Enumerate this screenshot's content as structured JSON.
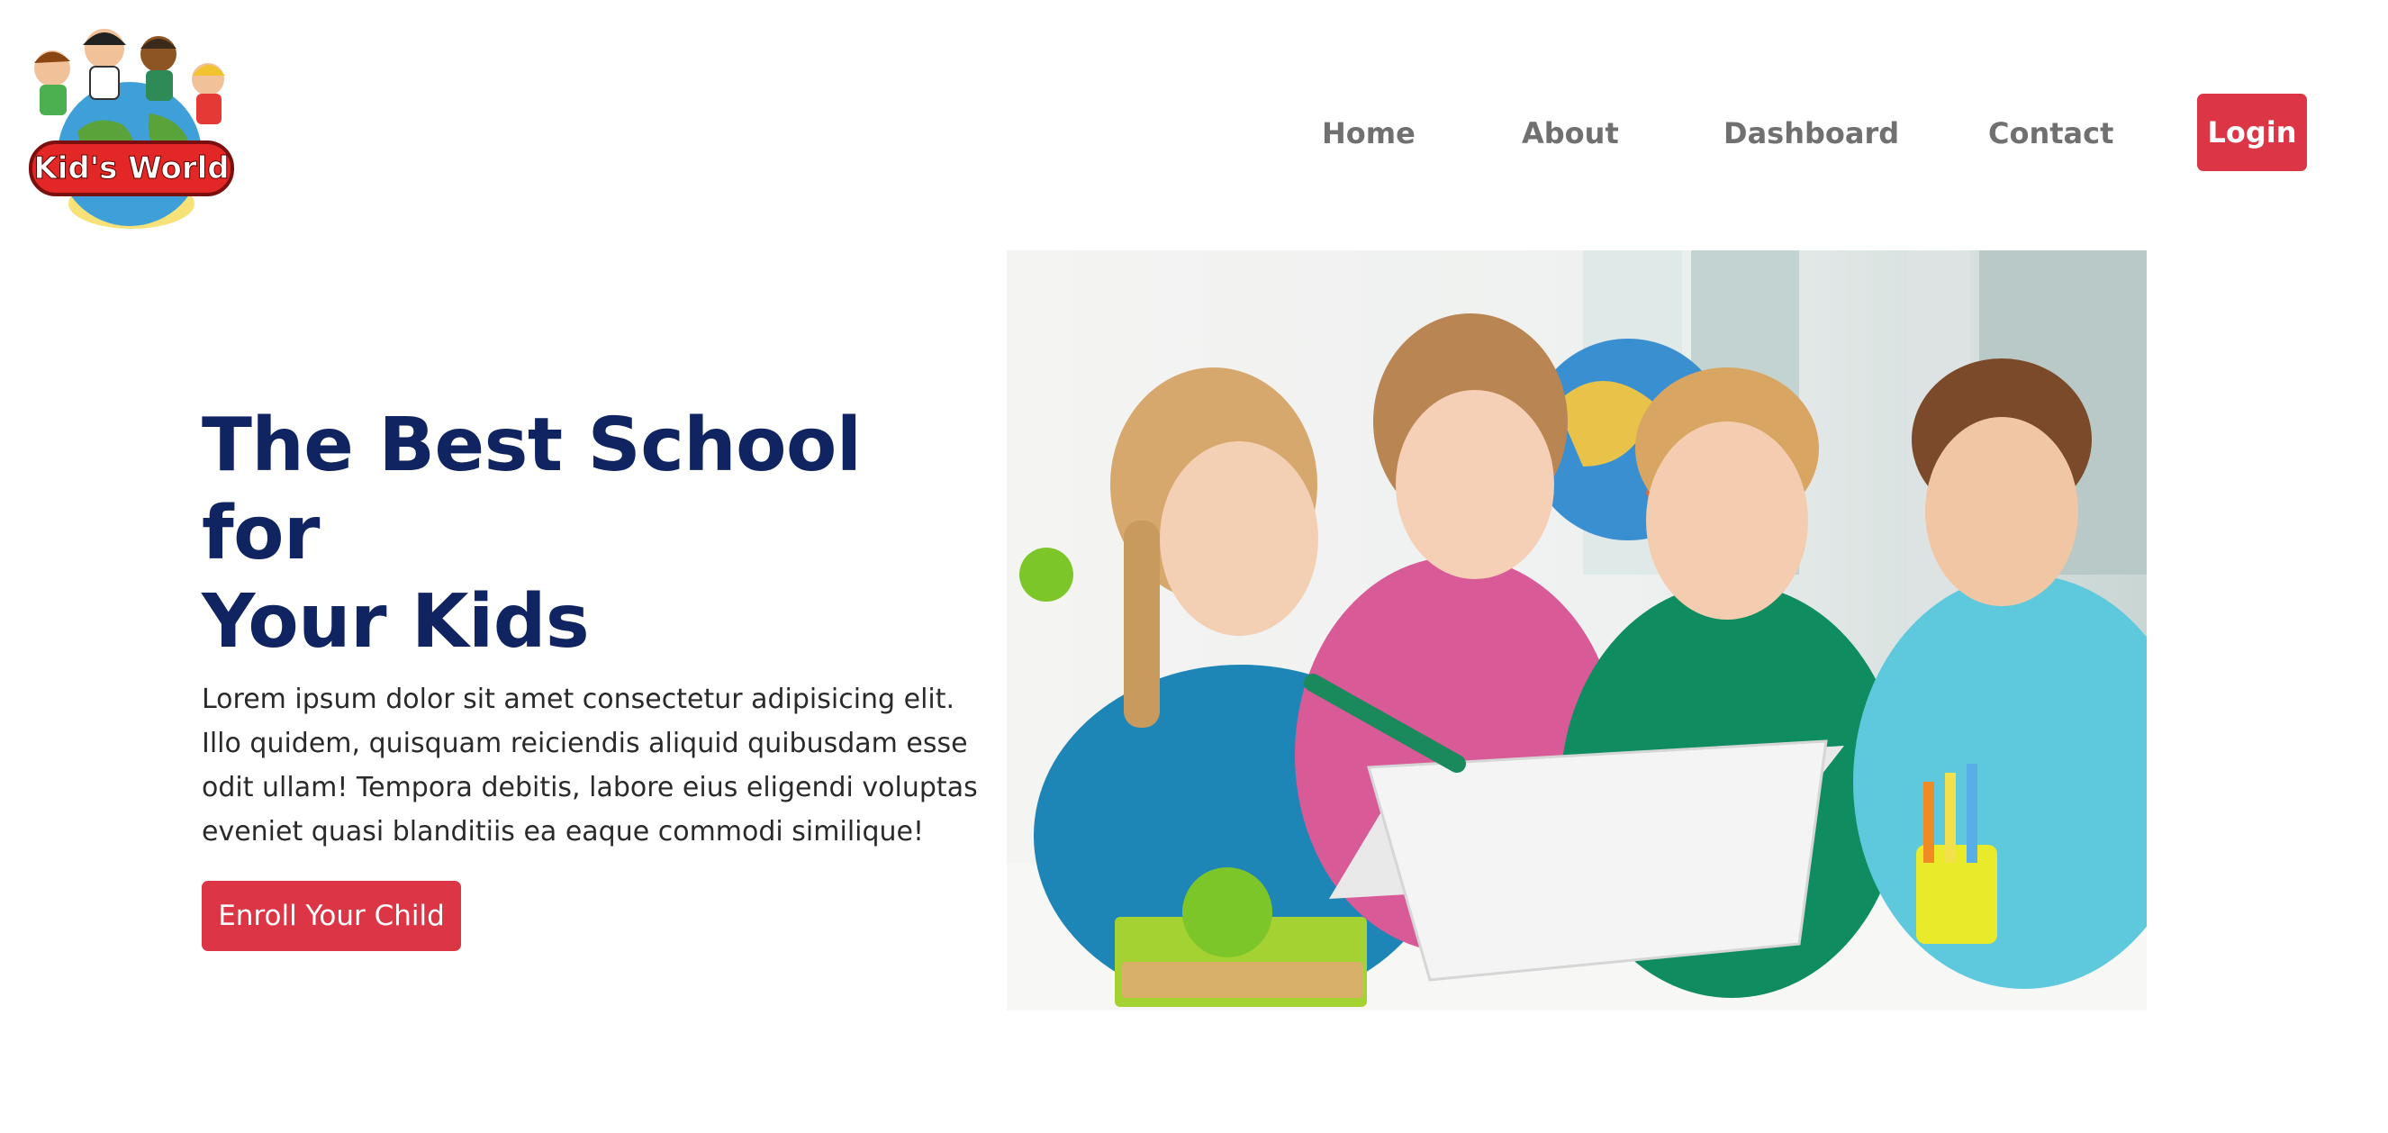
{
  "brand": {
    "logo_text": "Kid's World",
    "colors": {
      "primary": "#dc3545",
      "heading": "#0f2460",
      "nav_text": "#707070",
      "body_text": "#2a2a2a"
    }
  },
  "nav": {
    "items": [
      {
        "label": "Home"
      },
      {
        "label": "About"
      },
      {
        "label": "Dashboard"
      },
      {
        "label": "Contact"
      }
    ],
    "login_label": "Login"
  },
  "hero": {
    "title_line1": "The Best School for",
    "title_line2": "Your Kids",
    "description": "Lorem ipsum dolor sit amet consectetur adipisicing elit. Illo quidem, quisquam reiciendis aliquid quibusdam esse odit ullam! Tempora debitis, labore eius eligendi voluptas eveniet quasi blanditiis ea eaque commodi similique!",
    "cta_label": "Enroll Your Child",
    "image_icon": "photo-children-laptop"
  }
}
